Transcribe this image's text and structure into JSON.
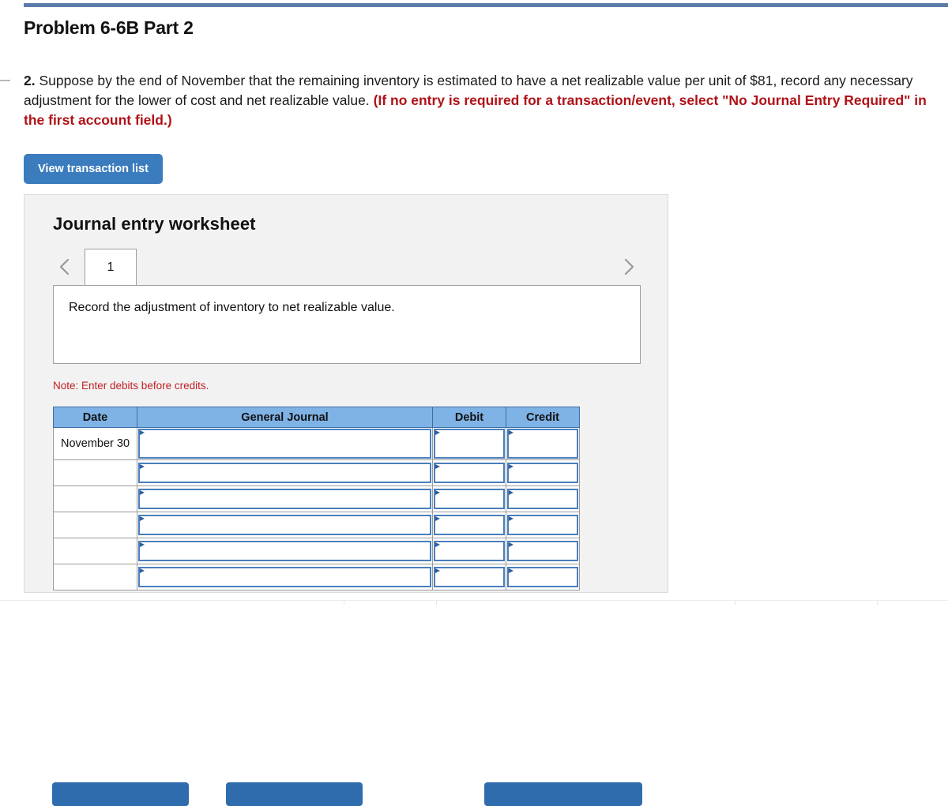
{
  "page": {
    "title": "Problem 6-6B Part 2"
  },
  "question": {
    "number": "2.",
    "body_before": " Suppose by the end of November that the remaining inventory is estimated to have a net realizable value per unit of $81, record any necessary adjustment for the lower of cost and net realizable value. ",
    "red_note": "(If no entry is required for a transaction/event, select \"No Journal Entry Required\" in the first account field.)"
  },
  "toolbar": {
    "view_transaction_list_label": "View transaction list"
  },
  "worksheet": {
    "title": "Journal entry worksheet",
    "prev_icon": "chevron-left-icon",
    "next_icon": "chevron-right-icon",
    "tabs": [
      {
        "label": "1",
        "selected": true
      }
    ],
    "description": "Record the adjustment of inventory to net realizable value.",
    "note": "Note: Enter debits before credits."
  },
  "table": {
    "headers": [
      "Date",
      "General Journal",
      "Debit",
      "Credit"
    ],
    "rows": [
      {
        "date": "November 30",
        "general_journal": "",
        "debit": "",
        "credit": ""
      },
      {
        "date": "",
        "general_journal": "",
        "debit": "",
        "credit": ""
      },
      {
        "date": "",
        "general_journal": "",
        "debit": "",
        "credit": ""
      },
      {
        "date": "",
        "general_journal": "",
        "debit": "",
        "credit": ""
      },
      {
        "date": "",
        "general_journal": "",
        "debit": "",
        "credit": ""
      },
      {
        "date": "",
        "general_journal": "",
        "debit": "",
        "credit": ""
      }
    ]
  },
  "footer_buttons": [
    {
      "label": ""
    },
    {
      "label": ""
    },
    {
      "label": ""
    }
  ],
  "colors": {
    "primary_button": "#3a7cbd",
    "table_header": "#7fb2e5",
    "field_border": "#4a7ebb",
    "red_note": "#b01217",
    "top_accent": "#5b7ca8",
    "card_background": "#f2f2f2"
  }
}
